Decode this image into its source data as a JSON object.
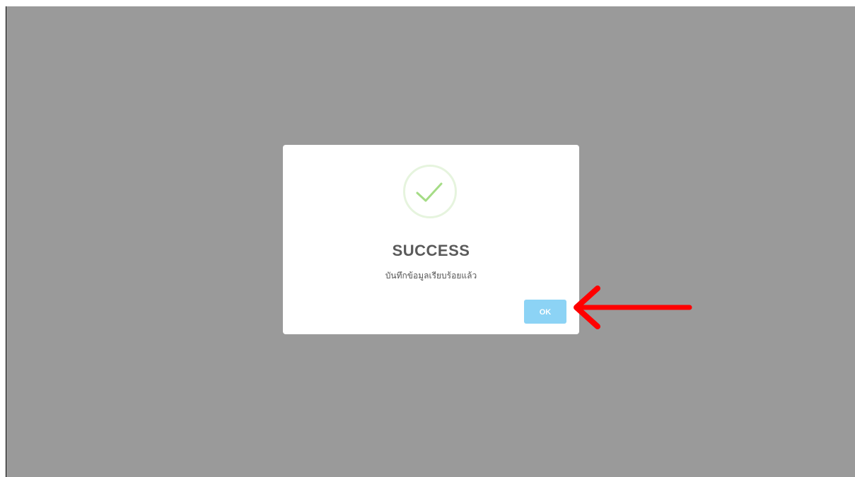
{
  "dialog": {
    "icon": "checkmark-circle-icon",
    "title": "SUCCESS",
    "message": "บันทึกข้อมูลเรียบร้อยแล้ว",
    "ok_label": "OK"
  },
  "annotation": {
    "icon": "red-arrow-pointing-left-icon",
    "color": "#ff0000"
  },
  "colors": {
    "overlay": "#9a9a9a",
    "success_check": "#a5dc86",
    "success_ring": "#e6f4de",
    "ok_button": "#8cd3f5"
  }
}
